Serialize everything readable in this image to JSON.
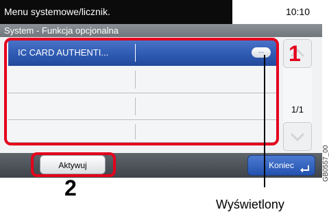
{
  "header": {
    "title": "Menu systemowe/licznik.",
    "time": "10:10",
    "subtitle": "System - Funkcja opcjonalna"
  },
  "list": {
    "rows": [
      {
        "label": "IC CARD AUTHENTI...",
        "selected": true,
        "badge": "..."
      },
      {
        "label": ""
      },
      {
        "label": ""
      },
      {
        "label": ""
      }
    ],
    "page": "1/1"
  },
  "buttons": {
    "activate": "Aktywuj",
    "finish": "Koniec"
  },
  "annotations": {
    "marker_1": "1",
    "marker_2": "2",
    "callout_text": "Wyświetlony",
    "image_code": "GB0557_00"
  },
  "colors": {
    "accent": "#2f5bb3",
    "highlight": "#e4001c"
  }
}
